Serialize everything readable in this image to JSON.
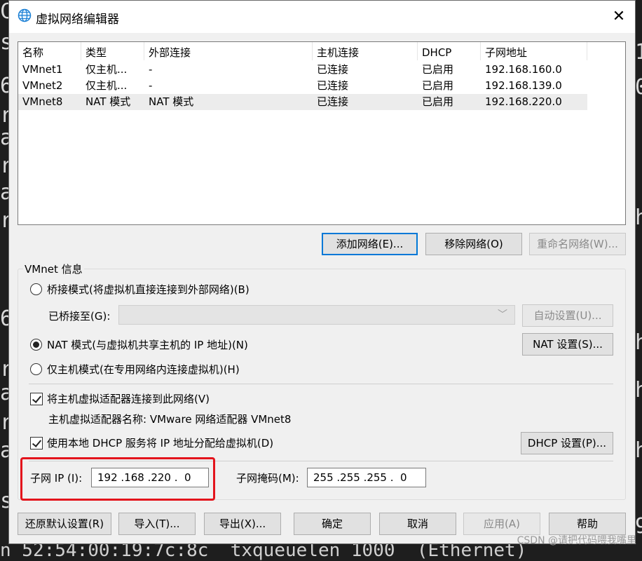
{
  "dialog": {
    "title": "虚拟网络编辑器",
    "close": "✕"
  },
  "table": {
    "headers": [
      "名称",
      "类型",
      "外部连接",
      "主机连接",
      "DHCP",
      "子网地址"
    ],
    "rows": [
      [
        "VMnet1",
        "仅主机...",
        "-",
        "已连接",
        "已启用",
        "192.168.160.0"
      ],
      [
        "VMnet2",
        "仅主机...",
        "-",
        "已连接",
        "已启用",
        "192.168.139.0"
      ],
      [
        "VMnet8",
        "NAT 模式",
        "NAT 模式",
        "已连接",
        "已启用",
        "192.168.220.0"
      ]
    ]
  },
  "network_buttons": {
    "add": "添加网络(E)...",
    "remove": "移除网络(O)",
    "rename": "重命名网络(W)..."
  },
  "vmnet_info": {
    "label": "VMnet 信息",
    "bridged": "桥接模式(将虚拟机直接连接到外部网络)(B)",
    "bridged_to": "已桥接至(G):",
    "auto_settings": "自动设置(U)...",
    "nat": "NAT 模式(与虚拟机共享主机的 IP 地址)(N)",
    "nat_settings": "NAT 设置(S)...",
    "host_only": "仅主机模式(在专用网络内连接虚拟机)(H)",
    "connect_adapter": "将主机虚拟适配器连接到此网络(V)",
    "adapter_name": "主机虚拟适配器名称: VMware 网络适配器 VMnet8",
    "use_dhcp": "使用本地 DHCP 服务将 IP 地址分配给虚拟机(D)",
    "dhcp_settings": "DHCP 设置(P)...",
    "subnet_ip_label": "子网 IP (I):",
    "subnet_ip": "192 .168 .220 .  0",
    "subnet_mask_label": "子网掩码(M):",
    "subnet_mask": "255 .255 .255 .  0"
  },
  "bottom_buttons": {
    "restore": "还原默认设置(R)",
    "import": "导入(T)...",
    "export": "导出(X)...",
    "ok": "确定",
    "cancel": "取消",
    "apply": "应用(A)",
    "help": "帮助"
  },
  "background": {
    "left_chars": [
      "C",
      "s",
      "6",
      "r",
      "a",
      "r",
      "a",
      "r",
      "6",
      "r",
      "a",
      "r",
      "a",
      "s"
    ],
    "right_chars": [
      "1",
      "0",
      "h",
      "h",
      "h",
      "h",
      "9"
    ],
    "bottom_line": "n 52:54:00:19:7c:8c  txqueuelen 1000  (Ethernet)"
  },
  "watermark": "CSDN @请把代码喂我嘴里"
}
